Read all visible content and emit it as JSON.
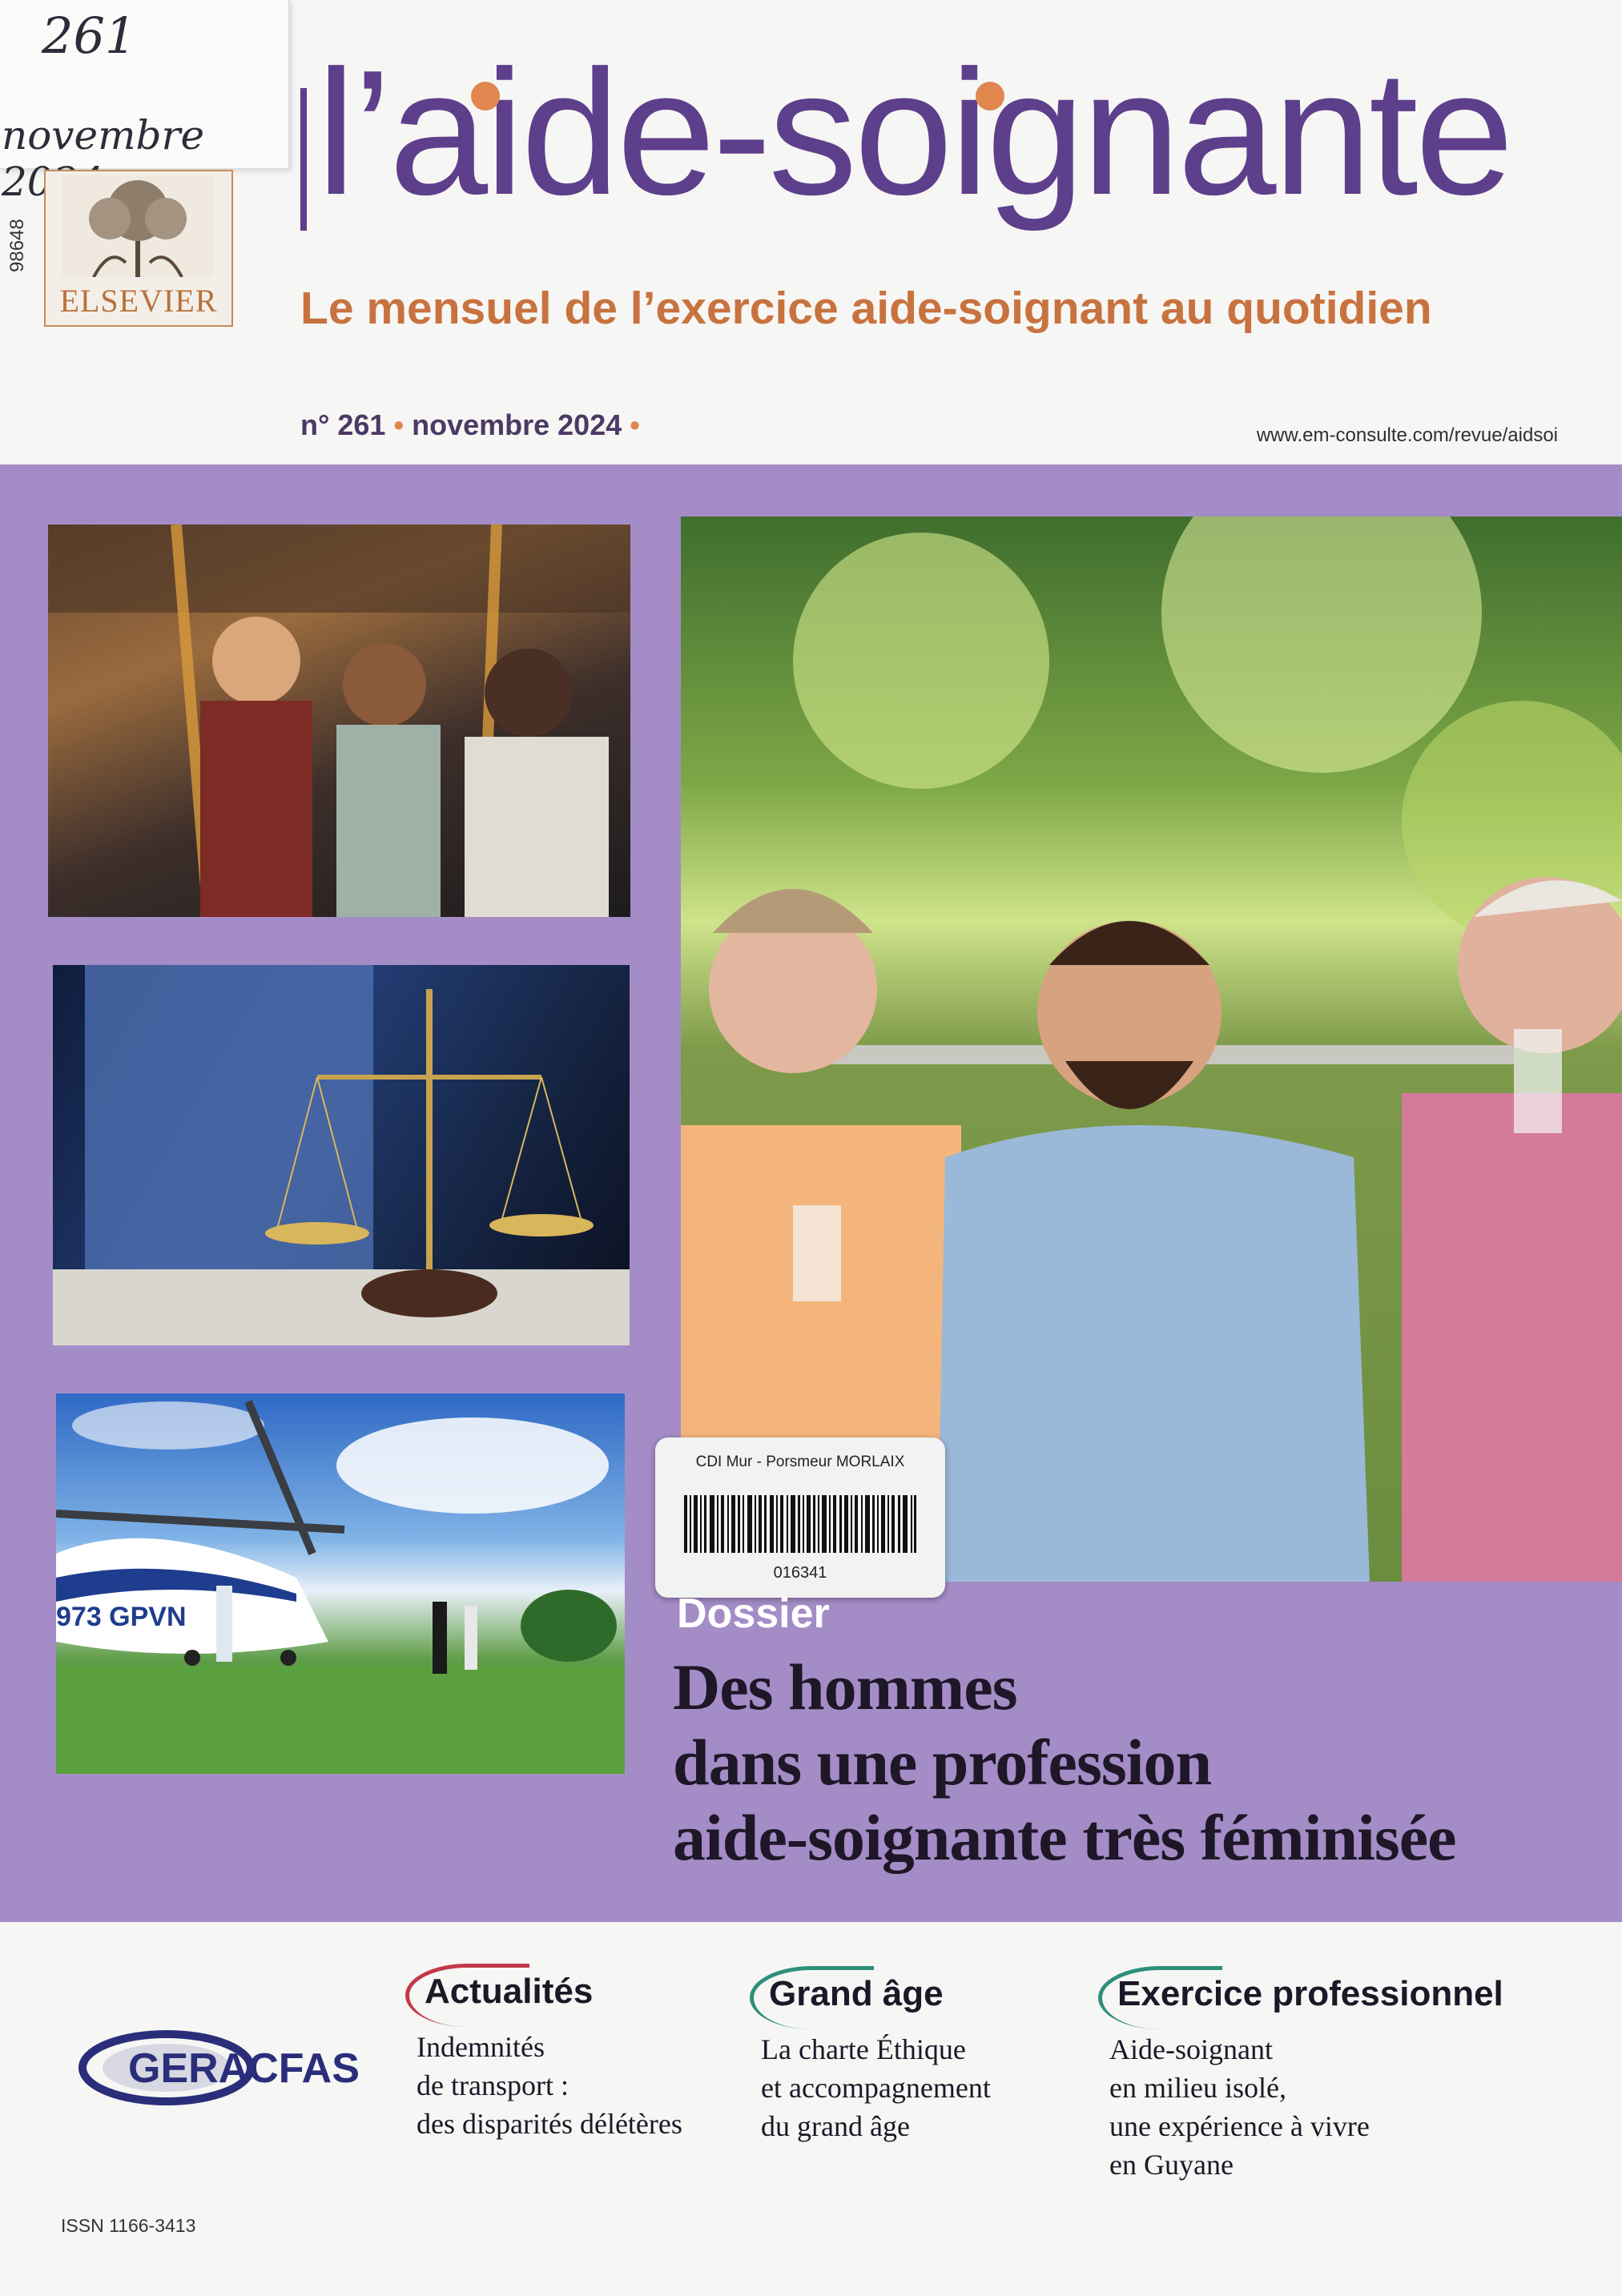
{
  "handwriting": {
    "number": "261",
    "date": "novembre 2024"
  },
  "publisher": {
    "name": "ELSEVIER",
    "spine_code": "98648"
  },
  "masthead": {
    "title": "l’aide-soignante",
    "subtitle": "Le mensuel de l’exercice aide-soignant au quotidien",
    "issue": "n° 261",
    "month": "novembre 2024",
    "url": "www.em-consulte.com/revue/aidsoi"
  },
  "library_label": {
    "institution": "CDI Mur - Porsmeur MORLAIX",
    "barcode_number": "016341"
  },
  "helicopter": {
    "tail_marking": "973 GPVN"
  },
  "dossier": {
    "kicker": "Dossier",
    "title_lines": [
      "Des hommes",
      "dans une profession",
      "aide-soignante très féminisée"
    ]
  },
  "sections": [
    {
      "heading": "Actualités",
      "lines": [
        "Indemnités",
        "de transport :",
        "des disparités délétères"
      ],
      "accent": "#c2384a"
    },
    {
      "heading": "Grand âge",
      "lines": [
        "La charte Éthique",
        "et accompagnement",
        "du grand âge"
      ],
      "accent": "#2e8f7c"
    },
    {
      "heading": "Exercice professionnel",
      "lines": [
        "Aide-soignant",
        "en milieu isolé,",
        "une expérience à vivre",
        "en Guyane"
      ],
      "accent": "#2e8f7c"
    }
  ],
  "partner_logo": "GERACFAS",
  "issn": "ISSN 1166-3413",
  "colors": {
    "brand_purple": "#5e3f8b",
    "accent_orange": "#e0864f",
    "band": "#a48cc6"
  }
}
